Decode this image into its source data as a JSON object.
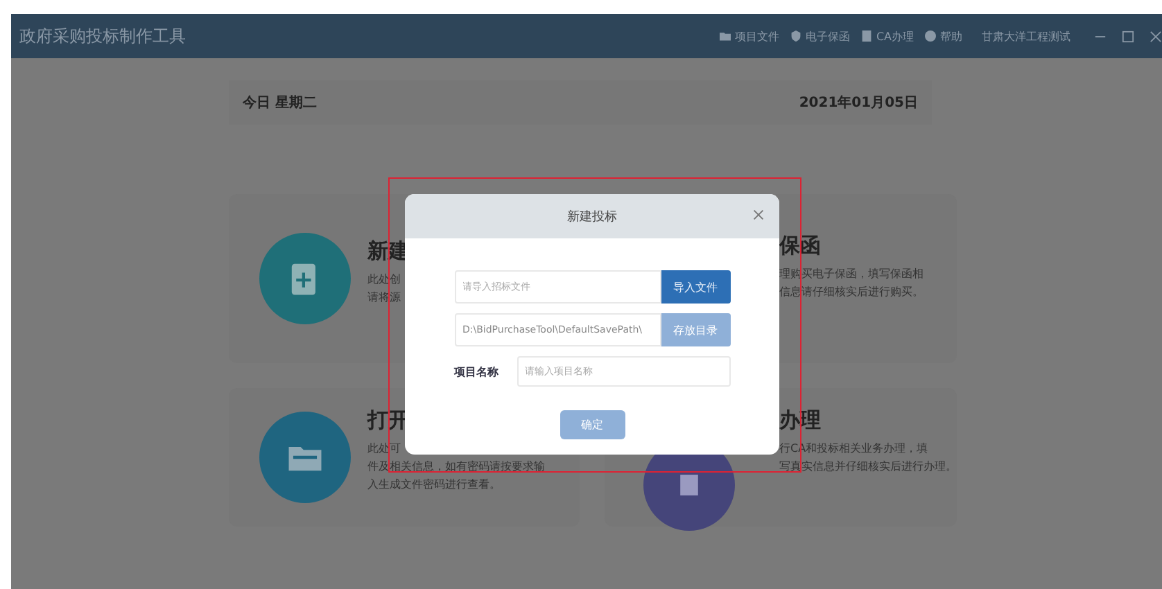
{
  "window": {
    "title": "政府采购投标制作工具"
  },
  "nav": [
    {
      "label": "项目文件",
      "kind": "folder"
    },
    {
      "label": "电子保函",
      "kind": "shield"
    },
    {
      "label": "CA办理",
      "kind": "card"
    },
    {
      "label": "帮助",
      "kind": "help"
    }
  ],
  "user": "甘肃大洋工程测试",
  "date_bar": {
    "weekday": "今日 星期二",
    "date": "2021年01月05日"
  },
  "cards": [
    {
      "title": "新建",
      "lines": [
        "此处创",
        "请将源"
      ],
      "kind": "new",
      "color": "#1f6f78"
    },
    {
      "title": "保函",
      "lines": [
        "理购买电子保函，填写保函相",
        "信息请仔细核实后进行购买。"
      ]
    },
    {
      "title": "打开",
      "lines": [
        "此处可",
        "件及相关信息，如有密码请按要求输",
        "入生成文件密码进行查看。"
      ],
      "kind": "folder",
      "color": "#1f6580"
    },
    {
      "title": "办理",
      "lines": [
        "行CA和投标相关业务办理，填",
        "写真实信息并仔细核实后进行办理。"
      ],
      "kind": "ca",
      "color": "#45457a"
    }
  ],
  "dialog": {
    "title": "新建投标",
    "import_field": {
      "placeholder": "请导入招标文件"
    },
    "import_button": {
      "label": "导入文件",
      "disabled": false
    },
    "path_field": {
      "value": "D:\\BidPurchaseTool\\DefaultSavePath\\"
    },
    "dir_button": {
      "label": "存放目录",
      "disabled": true
    },
    "name_label": "项目名称",
    "name_field": {
      "placeholder": "请输入项目名称"
    },
    "confirm_button": {
      "label": "确定",
      "disabled": true
    }
  }
}
